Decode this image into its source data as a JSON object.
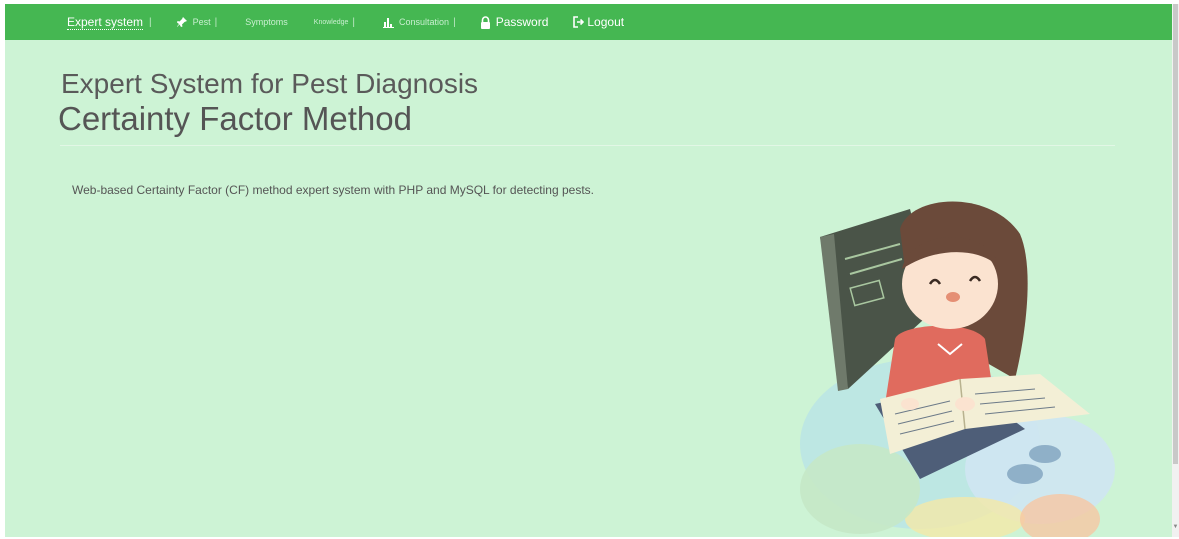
{
  "navbar": {
    "brand": "Expert system",
    "items": [
      {
        "label": "Pest",
        "icon": "pin-icon"
      },
      {
        "label": "Symptoms",
        "icon": ""
      },
      {
        "label": "Knowledge",
        "icon": ""
      },
      {
        "label": "Consultation",
        "icon": "chart-icon"
      },
      {
        "label": "Password",
        "icon": "lock-icon"
      },
      {
        "label": "Logout",
        "icon": "logout-icon"
      }
    ],
    "separator": "|"
  },
  "header": {
    "title": "Expert System for Pest Diagnosis",
    "subtitle": "Certainty Factor Method"
  },
  "main": {
    "description": "Web-based Certainty Factor (CF) method expert system with PHP and MySQL for detecting pests."
  },
  "colors": {
    "navbar": "#45b752",
    "background": "#cdf3d5",
    "text": "#555555"
  },
  "illustration": {
    "name": "girl-reading-book-illustration"
  }
}
